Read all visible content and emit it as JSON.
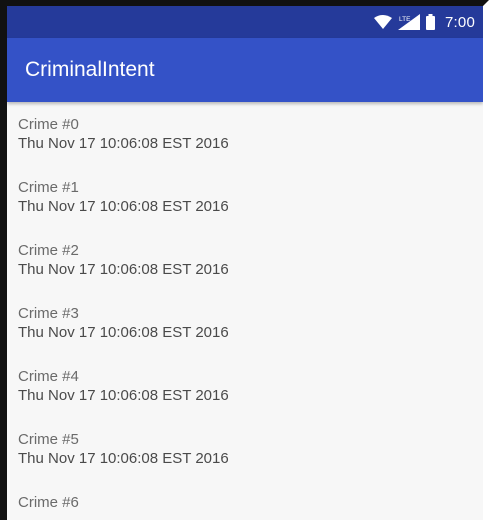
{
  "status_bar": {
    "time": "7:00",
    "network_label": "LTE",
    "icons": [
      "wifi-icon",
      "signal-icon",
      "battery-icon"
    ]
  },
  "app_bar": {
    "title": "CriminalIntent"
  },
  "colors": {
    "status_bar": "#253a9a",
    "app_bar": "#3452c7",
    "background": "#f7f7f7"
  },
  "crimes": [
    {
      "title": "Crime #0",
      "date": "Thu Nov 17 10:06:08 EST 2016"
    },
    {
      "title": "Crime #1",
      "date": "Thu Nov 17 10:06:08 EST 2016"
    },
    {
      "title": "Crime #2",
      "date": "Thu Nov 17 10:06:08 EST 2016"
    },
    {
      "title": "Crime #3",
      "date": "Thu Nov 17 10:06:08 EST 2016"
    },
    {
      "title": "Crime #4",
      "date": "Thu Nov 17 10:06:08 EST 2016"
    },
    {
      "title": "Crime #5",
      "date": "Thu Nov 17 10:06:08 EST 2016"
    },
    {
      "title": "Crime #6",
      "date": ""
    }
  ]
}
